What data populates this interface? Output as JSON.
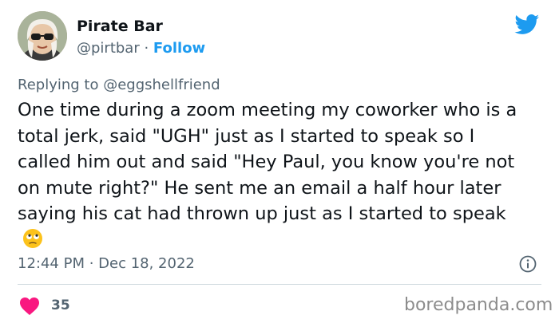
{
  "author": {
    "display_name": "Pirate Bar",
    "handle": "@pirtbar",
    "separator": " · ",
    "follow_label": "Follow"
  },
  "reply": {
    "prefix": "Replying to ",
    "mention": "@eggshellfriend"
  },
  "tweet": {
    "text": "One time during a zoom meeting my coworker who is a total jerk, said \"UGH\" just as I started to speak so I called him out and said \"Hey Paul, you know you're not on mute right?\" He sent me an email a half hour later saying his cat had thrown up just as I started to speak",
    "emoji": "face-with-rolling-eyes-emoji"
  },
  "meta": {
    "time": "12:44 PM",
    "separator": " · ",
    "date": "Dec 18, 2022"
  },
  "engagement": {
    "likes": "35"
  },
  "watermark": "boredpanda.com",
  "colors": {
    "accent": "#1d9bf0",
    "heart": "#f91880",
    "secondary_text": "#536471"
  }
}
